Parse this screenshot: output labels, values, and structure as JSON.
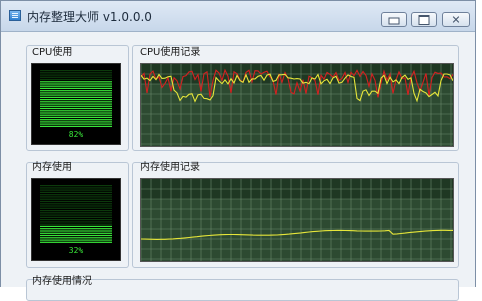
{
  "window": {
    "title": "内存整理大师 v1.0.0.0",
    "icons": {
      "app": "app-icon",
      "minimize": "minimize-icon",
      "maximize": "maximize-icon",
      "close": "close-icon"
    },
    "close_glyph": "✕"
  },
  "cpu": {
    "usage_label": "CPU使用",
    "usage_percent": "82%",
    "usage_value": 0.82,
    "history_label": "CPU使用记录"
  },
  "memory": {
    "usage_label": "内存使用",
    "usage_percent": "32%",
    "usage_value": 0.32,
    "history_label": "内存使用记录",
    "details_label": "内存使用情况"
  },
  "colors": {
    "meter_on": "#39e639",
    "meter_off": "#0c3a0c",
    "graph_bg": "#2d4a31",
    "graph_grid": "#6a8a6d",
    "line_red": "#d42020",
    "line_yellow": "#e6e63a"
  }
}
